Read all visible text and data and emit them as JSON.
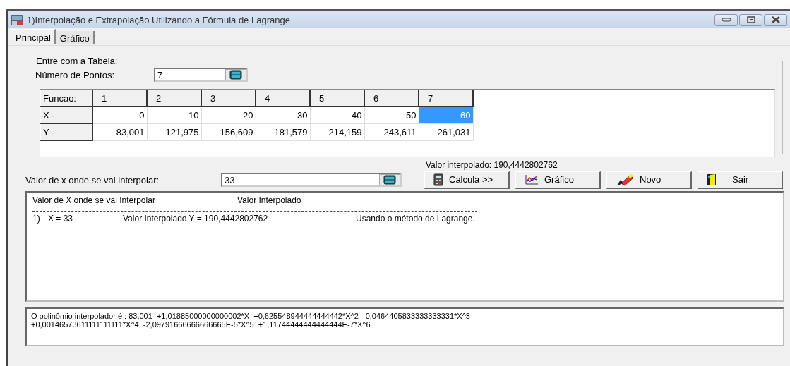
{
  "window": {
    "title": "1)Interpolação e Extrapolação Utilizando a Fórmula de Lagrange"
  },
  "tabs": [
    {
      "label": "Principal",
      "selected": true
    },
    {
      "label": "Gráfico",
      "selected": false
    }
  ],
  "table_group": {
    "legend": "Entre com a Tabela:",
    "points_label": "Número de Pontos:",
    "points_value": "7"
  },
  "grid": {
    "header": [
      "Funcao:",
      "1",
      "2",
      "3",
      "4",
      "5",
      "6",
      "7"
    ],
    "rows": [
      {
        "label": "X -",
        "cells": [
          {
            "text": "0",
            "selected": false
          },
          {
            "text": "10",
            "selected": false
          },
          {
            "text": "20",
            "selected": false
          },
          {
            "text": "30",
            "selected": false
          },
          {
            "text": "40",
            "selected": false
          },
          {
            "text": "50",
            "selected": false
          },
          {
            "text": "60",
            "selected": true
          }
        ]
      },
      {
        "label": "Y -",
        "cells": [
          {
            "text": "83,001",
            "selected": false
          },
          {
            "text": "121,975",
            "selected": false
          },
          {
            "text": "156,609",
            "selected": false
          },
          {
            "text": "181,579",
            "selected": false
          },
          {
            "text": "214,159",
            "selected": false
          },
          {
            "text": "243,611",
            "selected": false
          },
          {
            "text": "261,031",
            "selected": false
          }
        ]
      }
    ]
  },
  "interpolated_label": "Valor interpolado: 190,4442802762",
  "x_input": {
    "label": "Valor de x onde se vai interpolar:",
    "value": "33"
  },
  "buttons": [
    {
      "label": "Calcula >>",
      "kind": "calc"
    },
    {
      "label": "Gráfico",
      "kind": "chart"
    },
    {
      "label": "Novo",
      "kind": "new"
    },
    {
      "label": "Sair",
      "kind": "exit"
    }
  ],
  "results": {
    "columns": [
      "Valor de X onde se vai Interpolar",
      "Valor Interpolado"
    ],
    "lines": [
      {
        "index": "1)",
        "x": "X = 33",
        "value": "Valor Interpolado Y = 190,4442802762",
        "method": "Usando o método de Lagrange."
      }
    ]
  },
  "polynomial": [
    "O polinômio interpolador é : 83,001  +1,01885000000000002*X  +0,625548944444444442*X^2  -0,0464405833333333331*X^3",
    "+0,00146573611111111111*X^4  -2,09791666666666665E-5*X^5  +1,11744444444444444E-7*X^6"
  ]
}
